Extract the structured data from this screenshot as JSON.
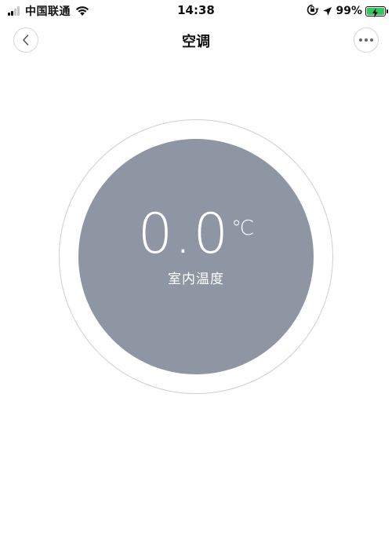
{
  "status_bar": {
    "carrier": "中国联通",
    "time": "14:38",
    "battery_percent": "99%",
    "battery_level": 0.99,
    "signal_bars_on": 2,
    "signal_bars_total": 4,
    "icons": [
      "signal-icon",
      "wifi-icon",
      "orientation-lock-icon",
      "location-icon",
      "battery-icon",
      "charging-bolt-icon"
    ],
    "battery_color": "#34c759"
  },
  "nav": {
    "title": "空调",
    "back_icon": "chevron-left-icon",
    "more_icon": "more-dots-icon"
  },
  "dial": {
    "temperature": "0.0",
    "unit": "℃",
    "label": "室内温度",
    "core_color": "#8e96a3",
    "ring_color": "#cfcfcf"
  }
}
